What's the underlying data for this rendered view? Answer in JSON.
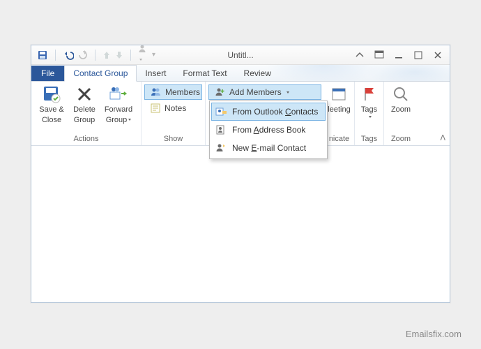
{
  "title": "Untitl...",
  "tabs": {
    "file": "File",
    "contact_group": "Contact Group",
    "insert": "Insert",
    "format_text": "Format Text",
    "review": "Review"
  },
  "ribbon": {
    "actions": {
      "label": "Actions",
      "save_close_l1": "Save &",
      "save_close_l2": "Close",
      "delete_l1": "Delete",
      "delete_l2": "Group",
      "forward_l1": "Forward",
      "forward_l2": "Group"
    },
    "show": {
      "label": "Show",
      "members": "Members",
      "notes": "Notes"
    },
    "add_members": {
      "button": "Add Members",
      "from_outlook_pre": "From Outlook ",
      "from_outlook_ul": "C",
      "from_outlook_post": "ontacts",
      "from_ab_pre": "From ",
      "from_ab_ul": "A",
      "from_ab_post": "ddress Book",
      "new_email_pre": "New ",
      "new_email_ul": "E",
      "new_email_post": "-mail Contact"
    },
    "comm": {
      "meeting": "leeting",
      "nicate": "nicate"
    },
    "tags": {
      "label": "Tags"
    },
    "zoom": {
      "button": "Zoom",
      "label": "Zoom"
    }
  },
  "brand": "Emailsfix.com"
}
